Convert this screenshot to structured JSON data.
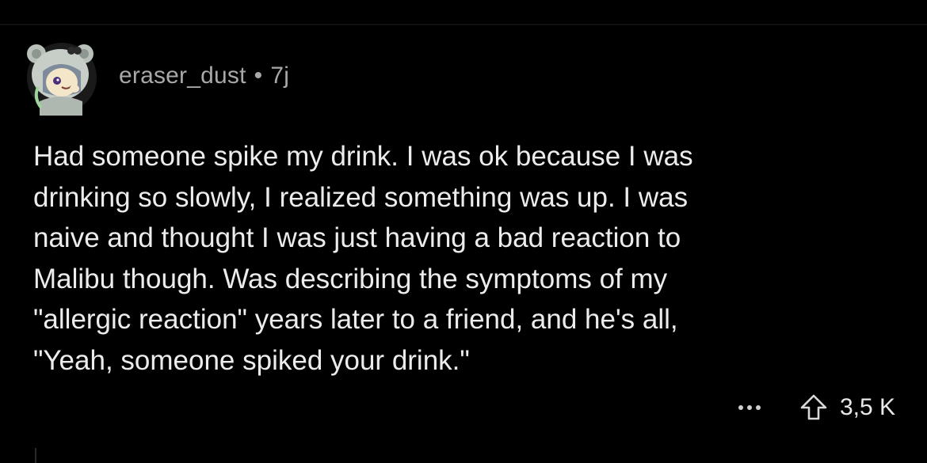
{
  "comment": {
    "username": "eraser_dust",
    "separator": "•",
    "age": "7j",
    "body": "Had someone spike my drink. I was ok because I was\ndrinking so slowly, I realized something was up. I was\nnaive and thought I was just having a bad reaction to\nMalibu though. Was describing the symptoms of my\n\"allergic reaction\" years later to a friend, and he's all,\n\"Yeah, someone spiked your drink.\"",
    "actions": {
      "more_icon": "ellipsis-icon",
      "upvote_icon": "upvote-arrow-icon",
      "vote_count": "3,5 K"
    }
  },
  "colors": {
    "background": "#000000",
    "text": "#ececec",
    "meta_text": "#a8a8a8"
  }
}
